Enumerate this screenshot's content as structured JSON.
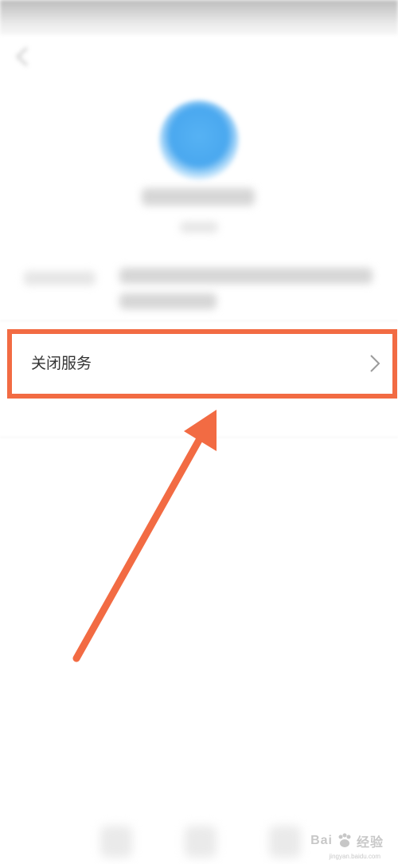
{
  "menu": {
    "close_service_label": "关闭服务"
  },
  "icons": {
    "back": "back-arrow-icon",
    "app": "app-logo-icon",
    "chevron": "chevron-right-icon",
    "annotation": "annotation-arrow"
  },
  "watermark": {
    "brand": "Bai",
    "brand_suffix": "经验",
    "url": "jingyan.baidu.com"
  },
  "colors": {
    "highlight": "#f26b43",
    "app_icon": "#4aa8ef",
    "label_text": "#333333"
  }
}
